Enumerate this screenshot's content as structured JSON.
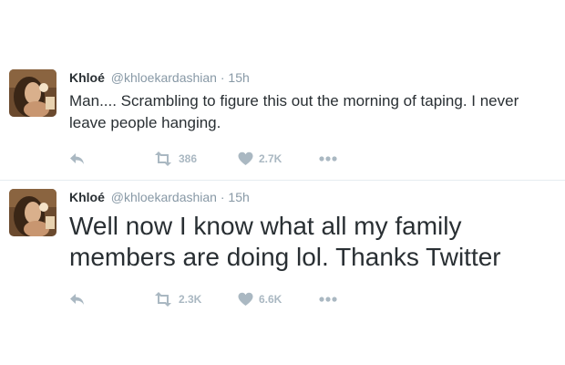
{
  "tweets": [
    {
      "author": {
        "name": "Khloé",
        "handle": "@khloekardashian"
      },
      "separator": "·",
      "time": "15h",
      "text": "Man.... Scrambling to figure this out the morning of taping. I never leave people hanging.",
      "stats": {
        "retweets": "386",
        "likes": "2.7K"
      }
    },
    {
      "author": {
        "name": "Khloé",
        "handle": "@khloekardashian"
      },
      "separator": "·",
      "time": "15h",
      "text": "Well now I know what all my family members are doing lol. Thanks Twitter",
      "stats": {
        "retweets": "2.3K",
        "likes": "6.6K"
      }
    }
  ],
  "icons": {
    "reply": "reply-icon",
    "retweet": "retweet-icon",
    "like": "heart-icon",
    "more": "more-icon"
  },
  "colors": {
    "name": "#292f33",
    "meta": "#8899a6",
    "icon": "#aab8c2",
    "divider": "#e6ecf0"
  }
}
